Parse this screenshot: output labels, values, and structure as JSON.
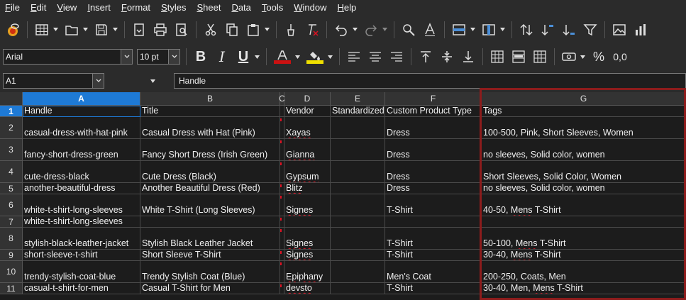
{
  "menu": [
    {
      "label": "File",
      "key": "F",
      "rest": "ile"
    },
    {
      "label": "Edit",
      "key": "E",
      "rest": "dit"
    },
    {
      "label": "View",
      "key": "V",
      "rest": "iew"
    },
    {
      "label": "Insert",
      "key": "I",
      "rest": "nsert"
    },
    {
      "label": "Format",
      "key": "F",
      "rest": "ormat"
    },
    {
      "label": "Styles",
      "key": "S",
      "rest": "tyles"
    },
    {
      "label": "Sheet",
      "key": "S",
      "rest": "heet"
    },
    {
      "label": "Data",
      "key": "D",
      "rest": "ata"
    },
    {
      "label": "Tools",
      "key": "T",
      "rest": "ools"
    },
    {
      "label": "Window",
      "key": "W",
      "rest": "indow"
    },
    {
      "label": "Help",
      "key": "H",
      "rest": "elp"
    }
  ],
  "format_toolbar": {
    "font_name": "Arial",
    "font_size": "10 pt",
    "bold_glyph": "B",
    "italic_glyph": "I",
    "underline_glyph": "U",
    "percent_glyph": "%",
    "decimal_glyph": "0,0"
  },
  "formula_bar": {
    "name_box": "A1",
    "input": "Handle"
  },
  "colors": {
    "accent": "#1e7ad6",
    "highlight_border": "#8d1c1c",
    "font_color_bar": "#cc1111",
    "highlight_bar": "#f0e000"
  },
  "columns": [
    "A",
    "B",
    "C",
    "D",
    "E",
    "F",
    "G"
  ],
  "rows": [
    {
      "num": "1",
      "cells": [
        "Handle",
        "Title",
        "",
        "Vendor",
        "Standardized",
        "Custom Product Type",
        "Tags"
      ]
    },
    {
      "num": "2",
      "cells": [
        "casual-dress-with-hat-pink",
        "Casual Dress with Hat (Pink)",
        "",
        "Xayas",
        "",
        "Dress",
        "100-500, Pink, Short Sleeves, Women"
      ]
    },
    {
      "num": "3",
      "cells": [
        "fancy-short-dress-green",
        "Fancy Short Dress (Irish Green)",
        "",
        "Gianna",
        "",
        "Dress",
        "no sleeves, Solid color, women"
      ]
    },
    {
      "num": "4",
      "cells": [
        "cute-dress-black",
        "Cute Dress (Black)",
        "",
        "Gypsum",
        "",
        "Dress",
        "Short Sleeves, Solid Color, Women"
      ]
    },
    {
      "num": "5",
      "cells": [
        "another-beautiful-dress",
        "Another Beautiful Dress (Red)",
        "",
        "Blitz",
        "",
        "Dress",
        "no sleeves, Solid color, women"
      ]
    },
    {
      "num": "6",
      "cells": [
        "white-t-shirt-long-sleeves",
        "White T-Shirt (Long Sleeves)",
        "",
        "Signes",
        "",
        "T-Shirt",
        "40-50, Mens T-Shirt"
      ]
    },
    {
      "num": "7",
      "cells": [
        "white-t-shirt-long-sleeves",
        "",
        "",
        "",
        "",
        "",
        ""
      ]
    },
    {
      "num": "8",
      "cells": [
        "stylish-black-leather-jacket",
        "Stylish Black Leather Jacket",
        "",
        "Signes",
        "",
        "T-Shirt",
        "50-100, Mens T-Shirt"
      ]
    },
    {
      "num": "9",
      "cells": [
        "short-sleeve-t-shirt",
        "Short Sleeve T-Shirt",
        "",
        "Signes",
        "",
        "T-Shirt",
        "30-40, Mens T-Shirt"
      ]
    },
    {
      "num": "10",
      "cells": [
        "trendy-stylish-coat-blue",
        "Trendy Stylish Coat (Blue)",
        "",
        "Epiphany",
        "",
        "Men's Coat",
        "200-250, Coats, Men"
      ]
    },
    {
      "num": "11",
      "cells": [
        "casual-t-shirt-for-men",
        "Casual T-Shirt for Men",
        "",
        "devsto",
        "",
        "T-Shirt",
        "30-40, Men, Mens T-Shirt"
      ]
    }
  ]
}
